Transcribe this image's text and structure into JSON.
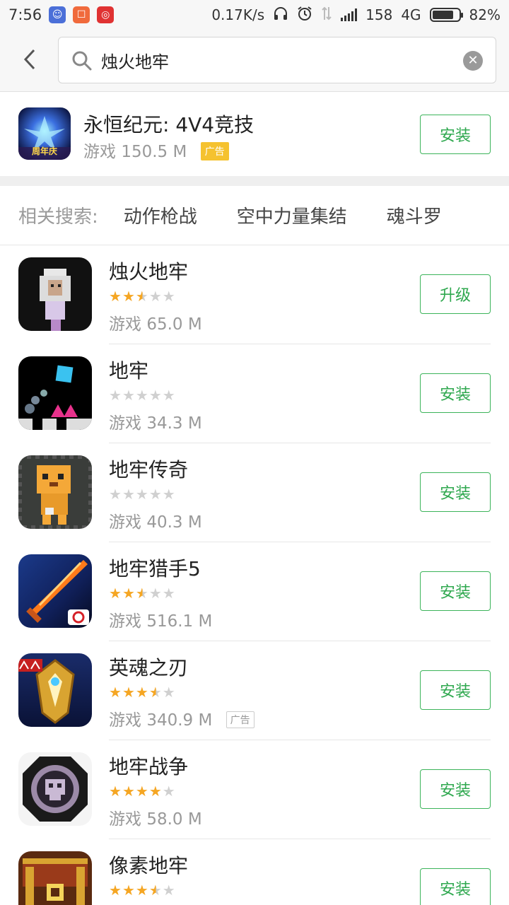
{
  "status_bar": {
    "time": "7:56",
    "net_speed": "0.17K/s",
    "signal_label": "158",
    "network": "4G",
    "battery": "82%",
    "battery_level": 0.82
  },
  "search": {
    "query": "烛火地牢"
  },
  "ad_app": {
    "name": "永恒纪元: 4V4竞技",
    "category": "游戏",
    "size": "150.5 M",
    "ad_label": "广告",
    "button": "安装",
    "icon_text": "周年庆"
  },
  "related": {
    "label": "相关搜索:",
    "items": [
      "动作枪战",
      "空中力量集结",
      "魂斗罗"
    ]
  },
  "apps": [
    {
      "name": "烛火地牢",
      "rating": 2.5,
      "category": "游戏",
      "size": "65.0 M",
      "button": "升级",
      "ad": ""
    },
    {
      "name": "地牢",
      "rating": 0,
      "category": "游戏",
      "size": "34.3 M",
      "button": "安装",
      "ad": ""
    },
    {
      "name": "地牢传奇",
      "rating": 0,
      "category": "游戏",
      "size": "40.3 M",
      "button": "安装",
      "ad": ""
    },
    {
      "name": "地牢猎手5",
      "rating": 2.5,
      "category": "游戏",
      "size": "516.1 M",
      "button": "安装",
      "ad": ""
    },
    {
      "name": "英魂之刃",
      "rating": 3.5,
      "category": "游戏",
      "size": "340.9 M",
      "button": "安装",
      "ad": "广告"
    },
    {
      "name": "地牢战争",
      "rating": 4,
      "category": "游戏",
      "size": "58.0 M",
      "button": "安装",
      "ad": ""
    },
    {
      "name": "像素地牢",
      "rating": 3.5,
      "category": "",
      "size": "",
      "button": "安装",
      "ad": ""
    }
  ],
  "icons_legend": {
    "back": "chevron-left-icon",
    "search": "search-icon",
    "clear": "clear-icon",
    "star": "star-icon"
  },
  "colors": {
    "accent_green": "#2fa84f",
    "star_on": "#f5a623",
    "star_off": "#d0d0d0",
    "ad_tag": "#f5c230"
  }
}
